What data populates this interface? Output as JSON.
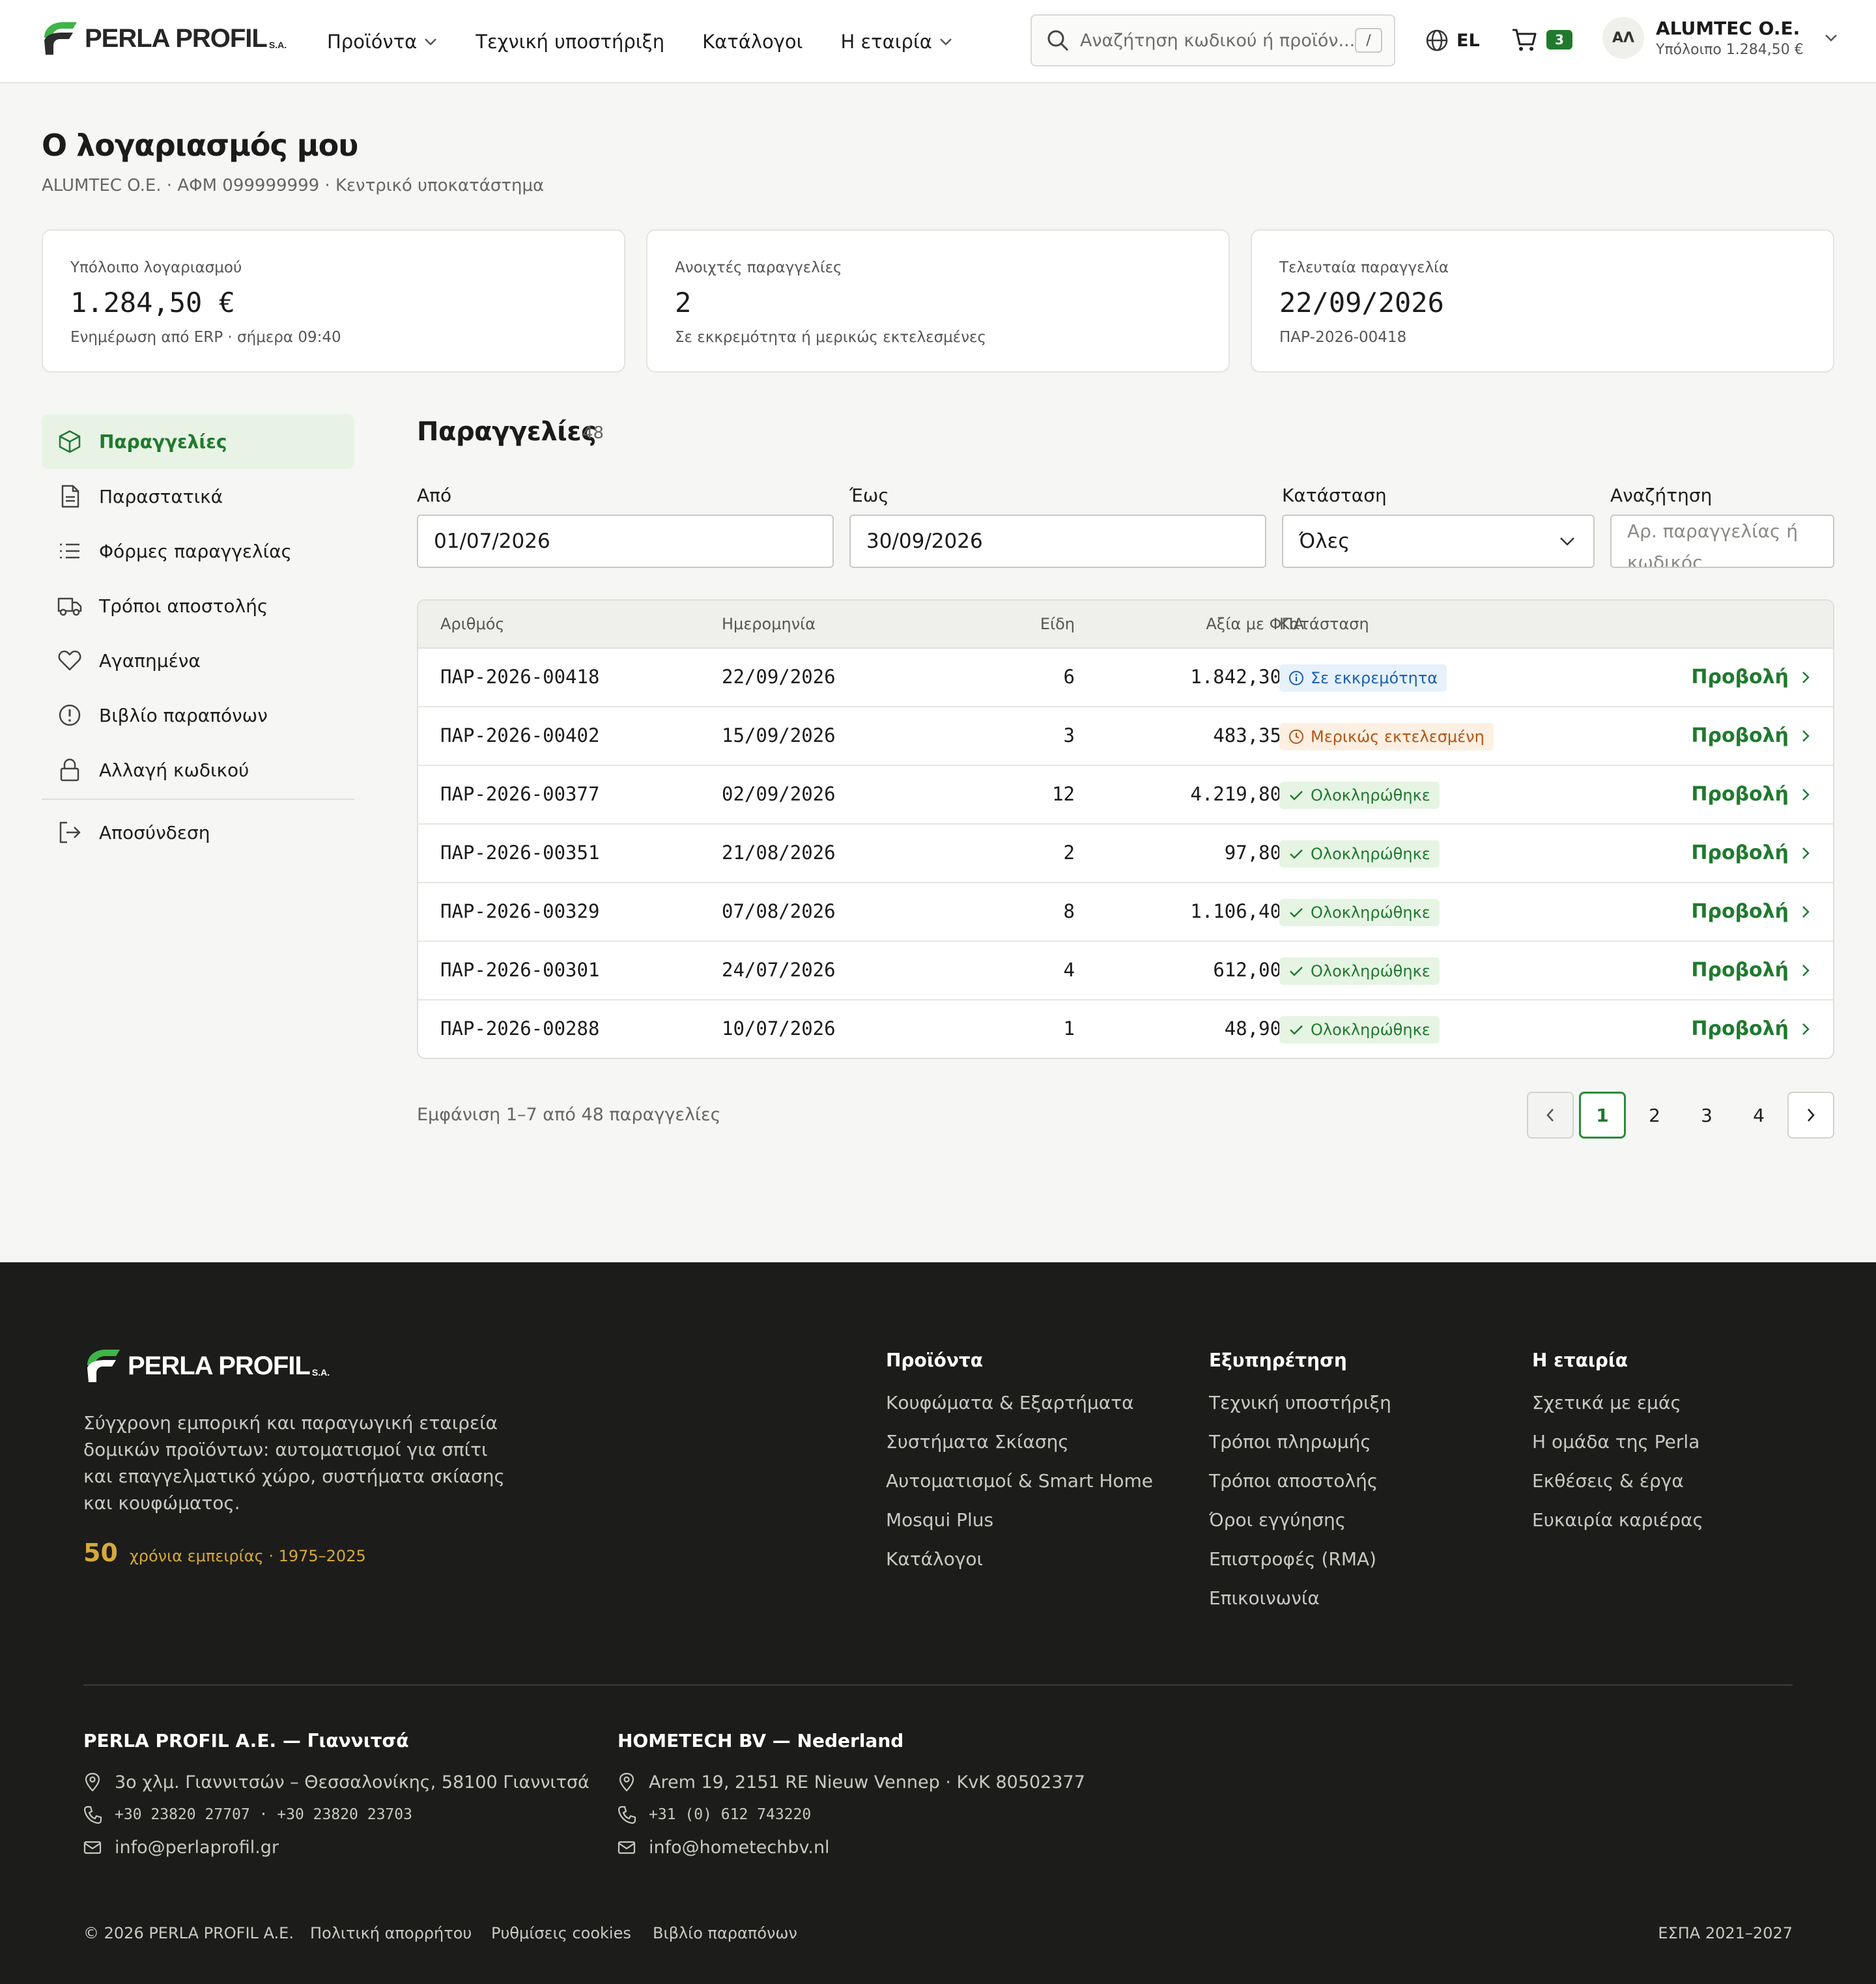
{
  "header": {
    "brand": "PERLA PROFIL",
    "brand_suffix": "S.A.",
    "nav": [
      "Προϊόντα",
      "Τεχνική υποστήριξη",
      "Κατάλογοι",
      "Η εταιρία"
    ],
    "search_placeholder": "Αναζήτηση κωδικού ή προϊόν...",
    "search_shortcut": "/",
    "language": "EL",
    "cart_count": "3",
    "avatar_initials": "ΑΛ",
    "account_name": "ALUMTEC O.E.",
    "account_balance": "Υπόλοιπο 1.284,50 €"
  },
  "page": {
    "title": "Ο λογαριασμός μου",
    "subtitle": "ALUMTEC O.E. · ΑΦΜ 099999999 · Κεντρικό υποκατάστημα"
  },
  "stats": [
    {
      "label": "Υπόλοιπο λογαριασμού",
      "value": "1.284,50 €",
      "sub": "Ενημέρωση από ERP · σήμερα 09:40"
    },
    {
      "label": "Ανοιχτές παραγγελίες",
      "value": "2",
      "sub": "Σε εκκρεμότητα ή μερικώς εκτελεσμένες"
    },
    {
      "label": "Τελευταία παραγγελία",
      "value": "22/09/2026",
      "sub": "ΠΑΡ-2026-00418"
    }
  ],
  "sidebar": {
    "items": [
      {
        "label": "Παραγγελίες",
        "icon": "box-icon",
        "active": true
      },
      {
        "label": "Παραστατικά",
        "icon": "document-icon"
      },
      {
        "label": "Φόρμες παραγγελίας",
        "icon": "list-icon"
      },
      {
        "label": "Τρόποι αποστολής",
        "icon": "truck-icon"
      },
      {
        "label": "Αγαπημένα",
        "icon": "heart-icon"
      },
      {
        "label": "Βιβλίο παραπόνων",
        "icon": "alert-circle-icon"
      },
      {
        "label": "Αλλαγή κωδικού",
        "icon": "lock-icon"
      }
    ],
    "logout": "Αποσύνδεση"
  },
  "orders": {
    "title": "Παραγγελίες",
    "count": "48",
    "filters": {
      "from_label": "Από",
      "from_value": "01/07/2026",
      "to_label": "Έως",
      "to_value": "30/09/2026",
      "status_label": "Κατάσταση",
      "status_value": "Όλες",
      "search_label": "Αναζήτηση",
      "search_placeholder": "Αρ. παραγγελίας ή κωδικός"
    },
    "columns": [
      "Αριθμός",
      "Ημερομηνία",
      "Είδη",
      "Αξία με ΦΠΑ",
      "Κατάσταση"
    ],
    "view_label": "Προβολή",
    "rows": [
      {
        "number": "ΠΑΡ-2026-00418",
        "date": "22/09/2026",
        "items": "6",
        "total": "1.842,30 €",
        "status": "Σε εκκρεμότητα",
        "kind": "pend"
      },
      {
        "number": "ΠΑΡ-2026-00402",
        "date": "15/09/2026",
        "items": "3",
        "total": "483,35 €",
        "status": "Μερικώς εκτελεσμένη",
        "kind": "part"
      },
      {
        "number": "ΠΑΡ-2026-00377",
        "date": "02/09/2026",
        "items": "12",
        "total": "4.219,80 €",
        "status": "Ολοκληρώθηκε",
        "kind": "done"
      },
      {
        "number": "ΠΑΡ-2026-00351",
        "date": "21/08/2026",
        "items": "2",
        "total": "97,80 €",
        "status": "Ολοκληρώθηκε",
        "kind": "done"
      },
      {
        "number": "ΠΑΡ-2026-00329",
        "date": "07/08/2026",
        "items": "8",
        "total": "1.106,40 €",
        "status": "Ολοκληρώθηκε",
        "kind": "done"
      },
      {
        "number": "ΠΑΡ-2026-00301",
        "date": "24/07/2026",
        "items": "4",
        "total": "612,00 €",
        "status": "Ολοκληρώθηκε",
        "kind": "done"
      },
      {
        "number": "ΠΑΡ-2026-00288",
        "date": "10/07/2026",
        "items": "1",
        "total": "48,90 €",
        "status": "Ολοκληρώθηκε",
        "kind": "done"
      }
    ],
    "showing": "Εμφάνιση 1–7 από 48 παραγγελίες",
    "pages": [
      "1",
      "2",
      "3",
      "4"
    ],
    "current_page": "1"
  },
  "footer": {
    "description": "Σύγχρονη εμπορική και παραγωγική εταιρεία δομικών προϊόντων: αυτοματισμοί για σπίτι και επαγγελματικό χώρο, συστήματα σκίασης και κουφώματος.",
    "years": "50",
    "years_text": "χρόνια εμπειρίας · 1975–2025",
    "columns": [
      {
        "title": "Προϊόντα",
        "links": [
          "Κουφώματα & Εξαρτήματα",
          "Συστήματα Σκίασης",
          "Αυτοματισμοί & Smart Home",
          "Mosqui Plus",
          "Κατάλογοι"
        ]
      },
      {
        "title": "Εξυπηρέτηση",
        "links": [
          "Τεχνική υποστήριξη",
          "Τρόποι πληρωμής",
          "Τρόποι αποστολής",
          "Όροι εγγύησης",
          "Επιστροφές (RMA)",
          "Επικοινωνία"
        ]
      },
      {
        "title": "Η εταιρία",
        "links": [
          "Σχετικά με εμάς",
          "Η ομάδα της Perla",
          "Εκθέσεις & έργα",
          "Ευκαιρία καριέρας"
        ]
      }
    ],
    "addresses": [
      {
        "title": "PERLA PROFIL A.E. — Γιαννιτσά",
        "address": "3ο χλμ. Γιαννιτσών – Θεσσαλονίκης, 58100 Γιαννιτσά",
        "phone": "+30 23820 27707 · +30 23820 23703",
        "email": "info@perlaprofil.gr"
      },
      {
        "title": "HOMETECH BV — Nederland",
        "address": "Arem 19, 2151 RE Nieuw Vennep · KvK 80502377",
        "phone": "+31 (0) 612 743220",
        "email": "info@hometechbv.nl"
      }
    ],
    "copyright": "© 2026 PERLA PROFIL A.E.",
    "legal": [
      "Πολιτική απορρήτου",
      "Ρυθμίσεις cookies",
      "Βιβλίο παραπόνων"
    ],
    "espa": "ΕΣΠΑ 2021–2027"
  },
  "colors": {
    "brand_green": "#1f7a2e",
    "pending_blue": "#1a5fb4",
    "partial_orange": "#b65414",
    "footer_bg": "#1c1c1a",
    "accent_gold": "#d6a93a"
  }
}
